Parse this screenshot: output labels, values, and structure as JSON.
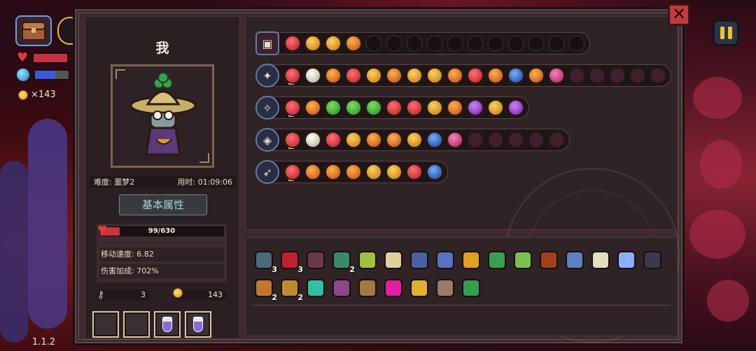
{
  "hud": {
    "coins": "×143",
    "version": "1.1.2"
  },
  "panel": {
    "player_name": "我",
    "difficulty": "难度: 噩梦2",
    "time_used": "用时: 01:09:06",
    "section_title": "基本属性",
    "hp": "99/630",
    "hp_fraction": 0.157,
    "move_speed": "移动速度: 6.82",
    "damage_bonus": "伤害加成: 702%",
    "keys": "3",
    "gold": "143"
  },
  "colors": {
    "panel_bg": "#3c2a2e",
    "accent_teal": "#9fd8d0",
    "hp_red": "#d03040",
    "close_red": "#c23a3a",
    "pause_yellow": "#f0c030"
  },
  "weapon_rows": [
    {
      "weapon": "chest-icon",
      "items": [
        "red",
        "gold",
        "gold",
        "orange",
        "empty",
        "empty",
        "empty",
        "empty",
        "empty",
        "empty",
        "empty",
        "empty",
        "empty",
        "empty",
        "empty"
      ]
    },
    {
      "weapon": "staff-icon",
      "items": [
        "red",
        "white",
        "orange",
        "red",
        "gold",
        "orange",
        "gold",
        "gold",
        "orange",
        "red",
        "orange",
        "blue",
        "orange",
        "pink",
        "locked",
        "locked",
        "locked",
        "locked",
        "locked"
      ]
    },
    {
      "weapon": "wand-icon",
      "items": [
        "red",
        "orange",
        "green",
        "green",
        "green",
        "red",
        "red",
        "gold",
        "orange",
        "purple",
        "gold",
        "purple"
      ]
    },
    {
      "weapon": "tome-icon",
      "items": [
        "red",
        "white",
        "red",
        "gold",
        "orange",
        "orange",
        "gold",
        "blue",
        "pink",
        "locked",
        "locked",
        "locked",
        "locked",
        "locked"
      ]
    },
    {
      "weapon": "spear-icon",
      "items": [
        "red",
        "orange",
        "orange",
        "orange",
        "gold",
        "gold",
        "red",
        "blue"
      ]
    }
  ],
  "inventory_row1": [
    {
      "color": "#4a6a7a",
      "count": "3"
    },
    {
      "color": "#c02030",
      "count": "3"
    },
    {
      "color": "#6a3a4a",
      "count": ""
    },
    {
      "color": "#3a8a6a",
      "count": "2"
    },
    {
      "color": "#a0c040",
      "count": ""
    },
    {
      "color": "#e0d0a0",
      "count": ""
    },
    {
      "color": "#4a60a0",
      "count": ""
    },
    {
      "color": "#5a70c0",
      "count": ""
    },
    {
      "color": "#e0a020",
      "count": ""
    },
    {
      "color": "#3aa050",
      "count": ""
    },
    {
      "color": "#7ac050",
      "count": ""
    },
    {
      "color": "#a04020",
      "count": ""
    },
    {
      "color": "#6080c0",
      "count": ""
    },
    {
      "color": "#e0e0c0",
      "count": ""
    },
    {
      "color": "#8ab0ff",
      "count": ""
    },
    {
      "color": "#3a3a4a",
      "count": ""
    }
  ],
  "inventory_row2": [
    {
      "color": "#c07830",
      "count": "2"
    },
    {
      "color": "#c08a30",
      "count": "2"
    },
    {
      "color": "#30c0a0",
      "count": ""
    },
    {
      "color": "#8a4a8a",
      "count": ""
    },
    {
      "color": "#a07a40",
      "count": ""
    },
    {
      "color": "#e020a0",
      "count": ""
    },
    {
      "color": "#e0b030",
      "count": ""
    },
    {
      "color": "#9a7a6a",
      "count": ""
    },
    {
      "color": "#30a050",
      "count": ""
    }
  ]
}
